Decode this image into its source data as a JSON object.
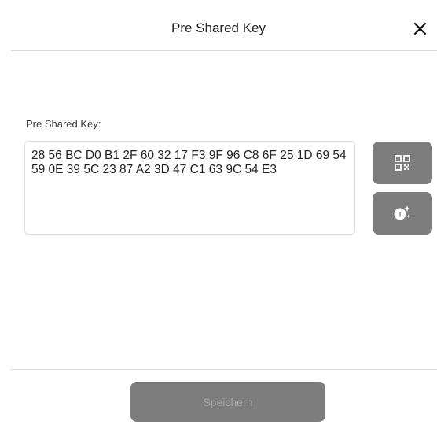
{
  "dialog": {
    "title": "Pre Shared Key",
    "close_icon": "close-icon"
  },
  "form": {
    "label": "Pre Shared Key:",
    "key_value": "28 56 BC D0 B1 2F 60 32 17 F3 9F 96 C8 6F 25 1D 69 54 59 0E 39 5C 23 87 A2 3D 47 C1 63 9C 54 E3"
  },
  "actions": {
    "scan_qr_icon": "qr-code-icon",
    "nfc_read_icon": "nfc-tag-icon",
    "save_label": "Speichern"
  },
  "colors": {
    "button_bg": "#7d7d7d",
    "button_text_disabled": "#a9a9a9",
    "divider": "#d9d9d9"
  }
}
